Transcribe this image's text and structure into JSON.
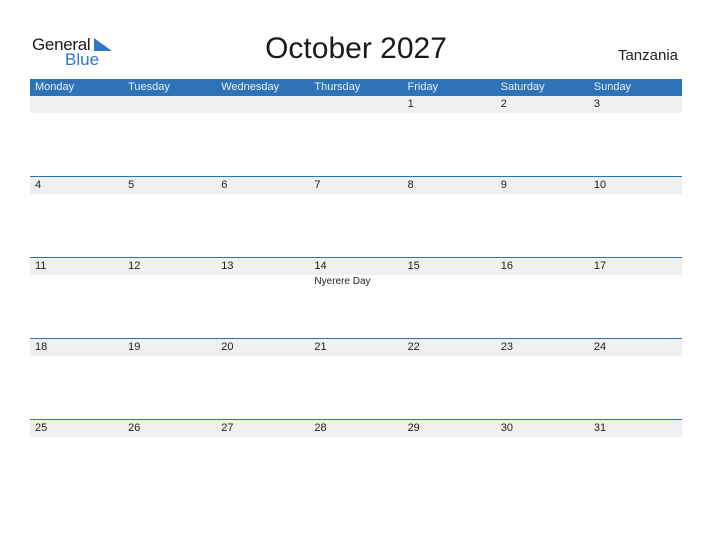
{
  "brand": {
    "line1": "General",
    "line2": "Blue",
    "accent": "#2f78c4"
  },
  "title": "October 2027",
  "country": "Tanzania",
  "header_color": "#2e73b8",
  "weekdays": [
    "Monday",
    "Tuesday",
    "Wednesday",
    "Thursday",
    "Friday",
    "Saturday",
    "Sunday"
  ],
  "weeks": [
    [
      {
        "day": ""
      },
      {
        "day": ""
      },
      {
        "day": ""
      },
      {
        "day": ""
      },
      {
        "day": "1"
      },
      {
        "day": "2"
      },
      {
        "day": "3"
      }
    ],
    [
      {
        "day": "4"
      },
      {
        "day": "5"
      },
      {
        "day": "6"
      },
      {
        "day": "7"
      },
      {
        "day": "8"
      },
      {
        "day": "9"
      },
      {
        "day": "10"
      }
    ],
    [
      {
        "day": "11"
      },
      {
        "day": "12"
      },
      {
        "day": "13"
      },
      {
        "day": "14",
        "event": "Nyerere Day"
      },
      {
        "day": "15"
      },
      {
        "day": "16"
      },
      {
        "day": "17"
      }
    ],
    [
      {
        "day": "18"
      },
      {
        "day": "19"
      },
      {
        "day": "20"
      },
      {
        "day": "21"
      },
      {
        "day": "22"
      },
      {
        "day": "23"
      },
      {
        "day": "24"
      }
    ],
    [
      {
        "day": "25"
      },
      {
        "day": "26"
      },
      {
        "day": "27"
      },
      {
        "day": "28"
      },
      {
        "day": "29"
      },
      {
        "day": "30"
      },
      {
        "day": "31"
      }
    ]
  ]
}
